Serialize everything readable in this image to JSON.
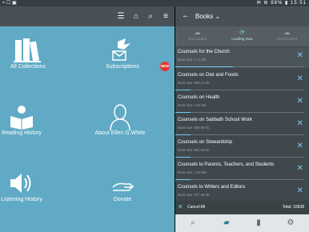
{
  "status": {
    "left": "≈ ☐ ▣",
    "right": "✉ ⚙ 88% ▮ 15:51"
  },
  "left_toolbar_icons": [
    "menu-list-icon",
    "home-icon",
    "search-icon",
    "hamburger-icon"
  ],
  "tiles": [
    {
      "label": "All Collections",
      "icon": "books-icon"
    },
    {
      "label": "Subscriptions",
      "icon": "dove-mail-icon"
    },
    {
      "label": "Reading History",
      "icon": "reader-icon"
    },
    {
      "label": "About Ellen G.White",
      "icon": "portrait-icon"
    },
    {
      "label": "Listening History",
      "icon": "speaker-icon"
    },
    {
      "label": "Donate",
      "icon": "hand-icon"
    }
  ],
  "badge": "NEW",
  "header": {
    "title": "Books ⌄"
  },
  "tabs": [
    {
      "label": "Not Loaded"
    },
    {
      "label": "Loading Now"
    },
    {
      "label": "Downloaded"
    }
  ],
  "books": [
    {
      "title": "Counsels for the Church",
      "size": "Book size: 1.11 Mb",
      "progress": 0.45
    },
    {
      "title": "Counsels on Diet and Foods",
      "size": "Book size: 958.21 Kb",
      "progress": 0.12
    },
    {
      "title": "Counsels on Health",
      "size": "Book size: 1.04 Mb",
      "progress": 0.12
    },
    {
      "title": "Counsels on Sabbath School Work",
      "size": "Book size: 600.69 Kb",
      "progress": 0.12
    },
    {
      "title": "Counsels on Stewardship",
      "size": "Book size: 991.03 Kb",
      "progress": 0.12
    },
    {
      "title": "Counsels to Parents, Teachers, and Students",
      "size": "Book size: 1.08 Mb",
      "progress": 0.12
    },
    {
      "title": "Counsels to Writers and Editors",
      "size": "Book size: 577.26 Kb",
      "progress": 0.12
    }
  ],
  "cancel_all": "Cancel All",
  "total": "Total: 10638",
  "bottom_nav": [
    "search-icon",
    "books-stack-icon",
    "bookmark-icon",
    "settings-icon"
  ]
}
